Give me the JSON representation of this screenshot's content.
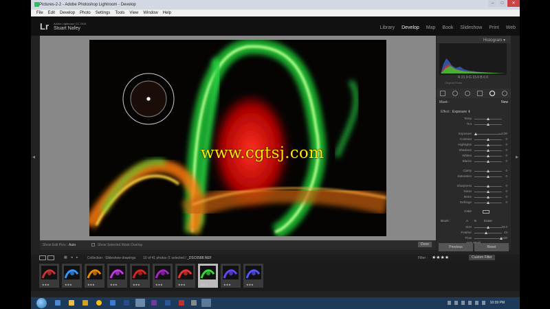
{
  "window": {
    "title": "Pictures-2-2 - Adobe Photoshop Lightroom - Develop",
    "controls": [
      "–",
      "□",
      "✕"
    ]
  },
  "menu": [
    "File",
    "Edit",
    "Develop",
    "Photo",
    "Settings",
    "Tools",
    "View",
    "Window",
    "Help"
  ],
  "identity": {
    "logo": "Lr",
    "product": "Adobe Lightroom CC 2015",
    "user": "Stuart Nafey"
  },
  "modules": [
    "Library",
    "Develop",
    "Map",
    "Book",
    "Slideshow",
    "Print",
    "Web"
  ],
  "active_module": "Develop",
  "toolbar": {
    "show_edit_pins_label": "Show Edit Pins :",
    "show_edit_pins_value": "Auto",
    "overlay_label": "Show Selected Mask Overlay",
    "done": "Done"
  },
  "right_panel": {
    "histogram_title": "Histogram",
    "hist_values": [
      "21.9",
      "15.6",
      "0.0"
    ],
    "original_photo": "Original Photo",
    "mask_label": "Mask :",
    "mask_new": "New",
    "effect_label": "Effect :",
    "effect_value": "Exposure",
    "sliders": [
      {
        "name": "Temp",
        "value": "",
        "pos": 0.5
      },
      {
        "name": "Tint",
        "value": "",
        "pos": 0.5
      },
      {
        "name": "Exposure",
        "value": "– 4.00",
        "pos": 0.05
      },
      {
        "name": "Contrast",
        "value": "0",
        "pos": 0.5
      },
      {
        "name": "Highlights",
        "value": "0",
        "pos": 0.5
      },
      {
        "name": "Shadows",
        "value": "0",
        "pos": 0.5
      },
      {
        "name": "Whites",
        "value": "0",
        "pos": 0.5
      },
      {
        "name": "Blacks",
        "value": "0",
        "pos": 0.5
      },
      {
        "name": "Clarity",
        "value": "0",
        "pos": 0.5
      },
      {
        "name": "Saturation",
        "value": "0",
        "pos": 0.5
      },
      {
        "name": "Sharpness",
        "value": "0",
        "pos": 0.5
      },
      {
        "name": "Noise",
        "value": "0",
        "pos": 0.5
      },
      {
        "name": "Moire",
        "value": "0",
        "pos": 0.5
      },
      {
        "name": "Defringe",
        "value": "0",
        "pos": 0.5
      }
    ],
    "color_label": "Color",
    "brush_label": "Brush :",
    "brush_tabs": [
      "A",
      "B",
      "Erase"
    ],
    "brush_sliders": [
      {
        "name": "Size",
        "value": "23.0",
        "pos": 0.5
      },
      {
        "name": "Feather",
        "value": "43",
        "pos": 0.42
      },
      {
        "name": "Flow",
        "value": "100",
        "pos": 0.98
      }
    ],
    "auto_mask": "Auto Mask",
    "previous": "Previous",
    "reset": "Reset"
  },
  "filmstrip": {
    "source": "Collection : Slideshow drawings",
    "count": "10 of 41 photos /1 selected /",
    "filename": "_DSC6588.NEF",
    "filter_label": "Filter :",
    "filter_value": "Custom Filter",
    "thumbs": [
      {
        "color": "#c33",
        "stars": "★★★"
      },
      {
        "color": "#39f",
        "stars": "★★★"
      },
      {
        "color": "#e80",
        "stars": "★★★"
      },
      {
        "color": "#c3e",
        "stars": "★★★"
      },
      {
        "color": "#d22",
        "stars": "★★★"
      },
      {
        "color": "#a2c",
        "stars": "★★★"
      },
      {
        "color": "#e33",
        "stars": "★★★"
      },
      {
        "color": "#3d3",
        "stars": "★★★"
      },
      {
        "color": "#64f",
        "stars": "★★★"
      },
      {
        "color": "#55f",
        "stars": "★★★"
      }
    ]
  },
  "taskbar": {
    "clock": "10:39 PM"
  },
  "watermark": "www.cgtsj.com"
}
